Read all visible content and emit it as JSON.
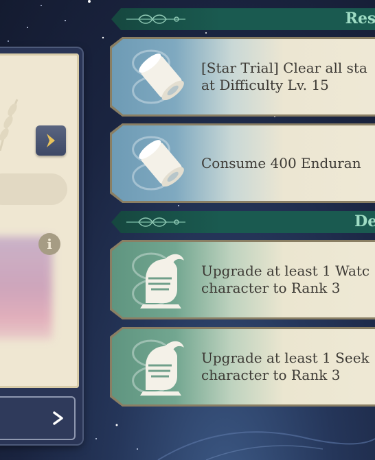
{
  "sections": [
    {
      "title": "Reso",
      "tasks": [
        {
          "icon": "scroll-icon",
          "line1": "[Star Trial] Clear all sta",
          "line2": "at Difficulty Lv. 15"
        },
        {
          "icon": "scroll-icon",
          "line1": "Consume 400 Enduran",
          "line2": ""
        }
      ]
    },
    {
      "title": "Dev",
      "tasks": [
        {
          "icon": "knight-helmet-icon",
          "line1": "Upgrade at least 1 Watc",
          "line2": "character to Rank 3"
        },
        {
          "icon": "knight-helmet-icon",
          "line1": "Upgrade at least 1 Seek",
          "line2": "character to Rank 3"
        }
      ]
    }
  ],
  "left_panel": {
    "info_symbol": "i"
  },
  "colors": {
    "header_bg": "#1a5a50",
    "header_text": "#9fdcc4",
    "card_text": "#3d3a35",
    "blue_accent": "#6e9bb5",
    "green_accent": "#5f9580"
  }
}
